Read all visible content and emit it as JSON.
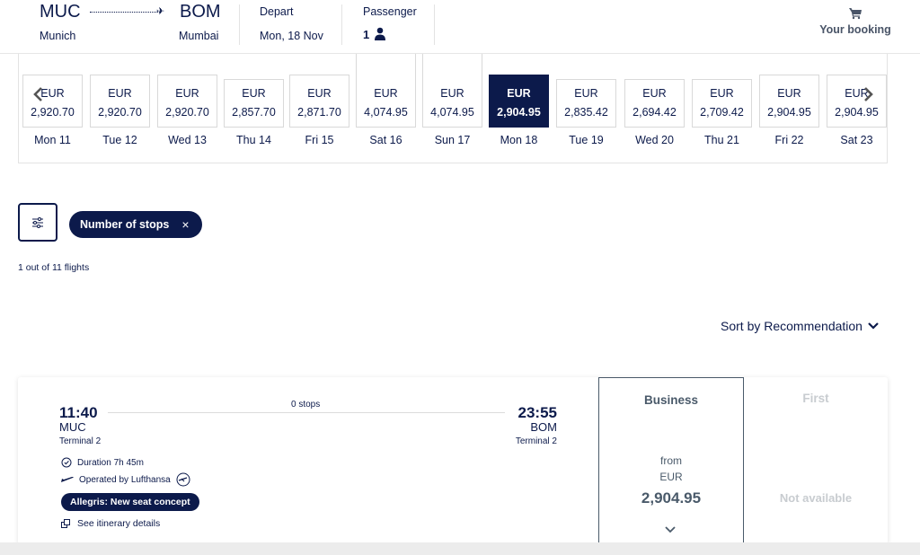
{
  "header": {
    "from_code": "MUC",
    "from_city": "Munich",
    "to_code": "BOM",
    "to_city": "Mumbai",
    "depart_label": "Depart",
    "depart_value": "Mon, 18 Nov",
    "passenger_label": "Passenger",
    "passenger_count": "1",
    "booking_label": "Your booking",
    "icons": {
      "route": "plane-icon",
      "passenger": "person-icon",
      "booking": "cart-icon"
    }
  },
  "dates": [
    {
      "day": "Mon 11",
      "currency": "EUR",
      "price": "2,920.70",
      "selected": false
    },
    {
      "day": "Tue 12",
      "currency": "EUR",
      "price": "2,920.70",
      "selected": false
    },
    {
      "day": "Wed 13",
      "currency": "EUR",
      "price": "2,920.70",
      "selected": false
    },
    {
      "day": "Thu 14",
      "currency": "EUR",
      "price": "2,857.70",
      "selected": false
    },
    {
      "day": "Fri 15",
      "currency": "EUR",
      "price": "2,871.70",
      "selected": false
    },
    {
      "day": "Sat 16",
      "currency": "EUR",
      "price": "4,074.95",
      "selected": false
    },
    {
      "day": "Sun 17",
      "currency": "EUR",
      "price": "4,074.95",
      "selected": false
    },
    {
      "day": "Mon 18",
      "currency": "EUR",
      "price": "2,904.95",
      "selected": true
    },
    {
      "day": "Tue 19",
      "currency": "EUR",
      "price": "2,835.42",
      "selected": false
    },
    {
      "day": "Wed 20",
      "currency": "EUR",
      "price": "2,694.42",
      "selected": false
    },
    {
      "day": "Thu 21",
      "currency": "EUR",
      "price": "2,709.42",
      "selected": false
    },
    {
      "day": "Fri 22",
      "currency": "EUR",
      "price": "2,904.95",
      "selected": false
    },
    {
      "day": "Sat 23",
      "currency": "EUR",
      "price": "2,904.95",
      "selected": false
    }
  ],
  "filters": {
    "filter_button_icon": "sliders-icon",
    "active_chip": "Number of stops",
    "chip_remove": "×",
    "results_count": "1 out of 11 flights"
  },
  "sort": {
    "label": "Sort by Recommendation"
  },
  "flight": {
    "departure_time": "11:40",
    "departure_code": "MUC",
    "departure_terminal": "Terminal 2",
    "arrival_time": "23:55",
    "arrival_code": "BOM",
    "arrival_terminal": "Terminal 2",
    "stops": "0 stops",
    "duration": "Duration 7h 45m",
    "operator": "Operated by Lufthansa",
    "badge": "Allegris: New seat concept",
    "itinerary_link": "See itinerary details"
  },
  "fares": {
    "business": {
      "class": "Business",
      "from": "from",
      "currency": "EUR",
      "price": "2,904.95"
    },
    "first": {
      "class": "First",
      "status": "Not available"
    }
  },
  "colors": {
    "brand": "#0c1a4b",
    "fare_text": "#4a5a6a",
    "disabled": "#c8ccd0"
  }
}
